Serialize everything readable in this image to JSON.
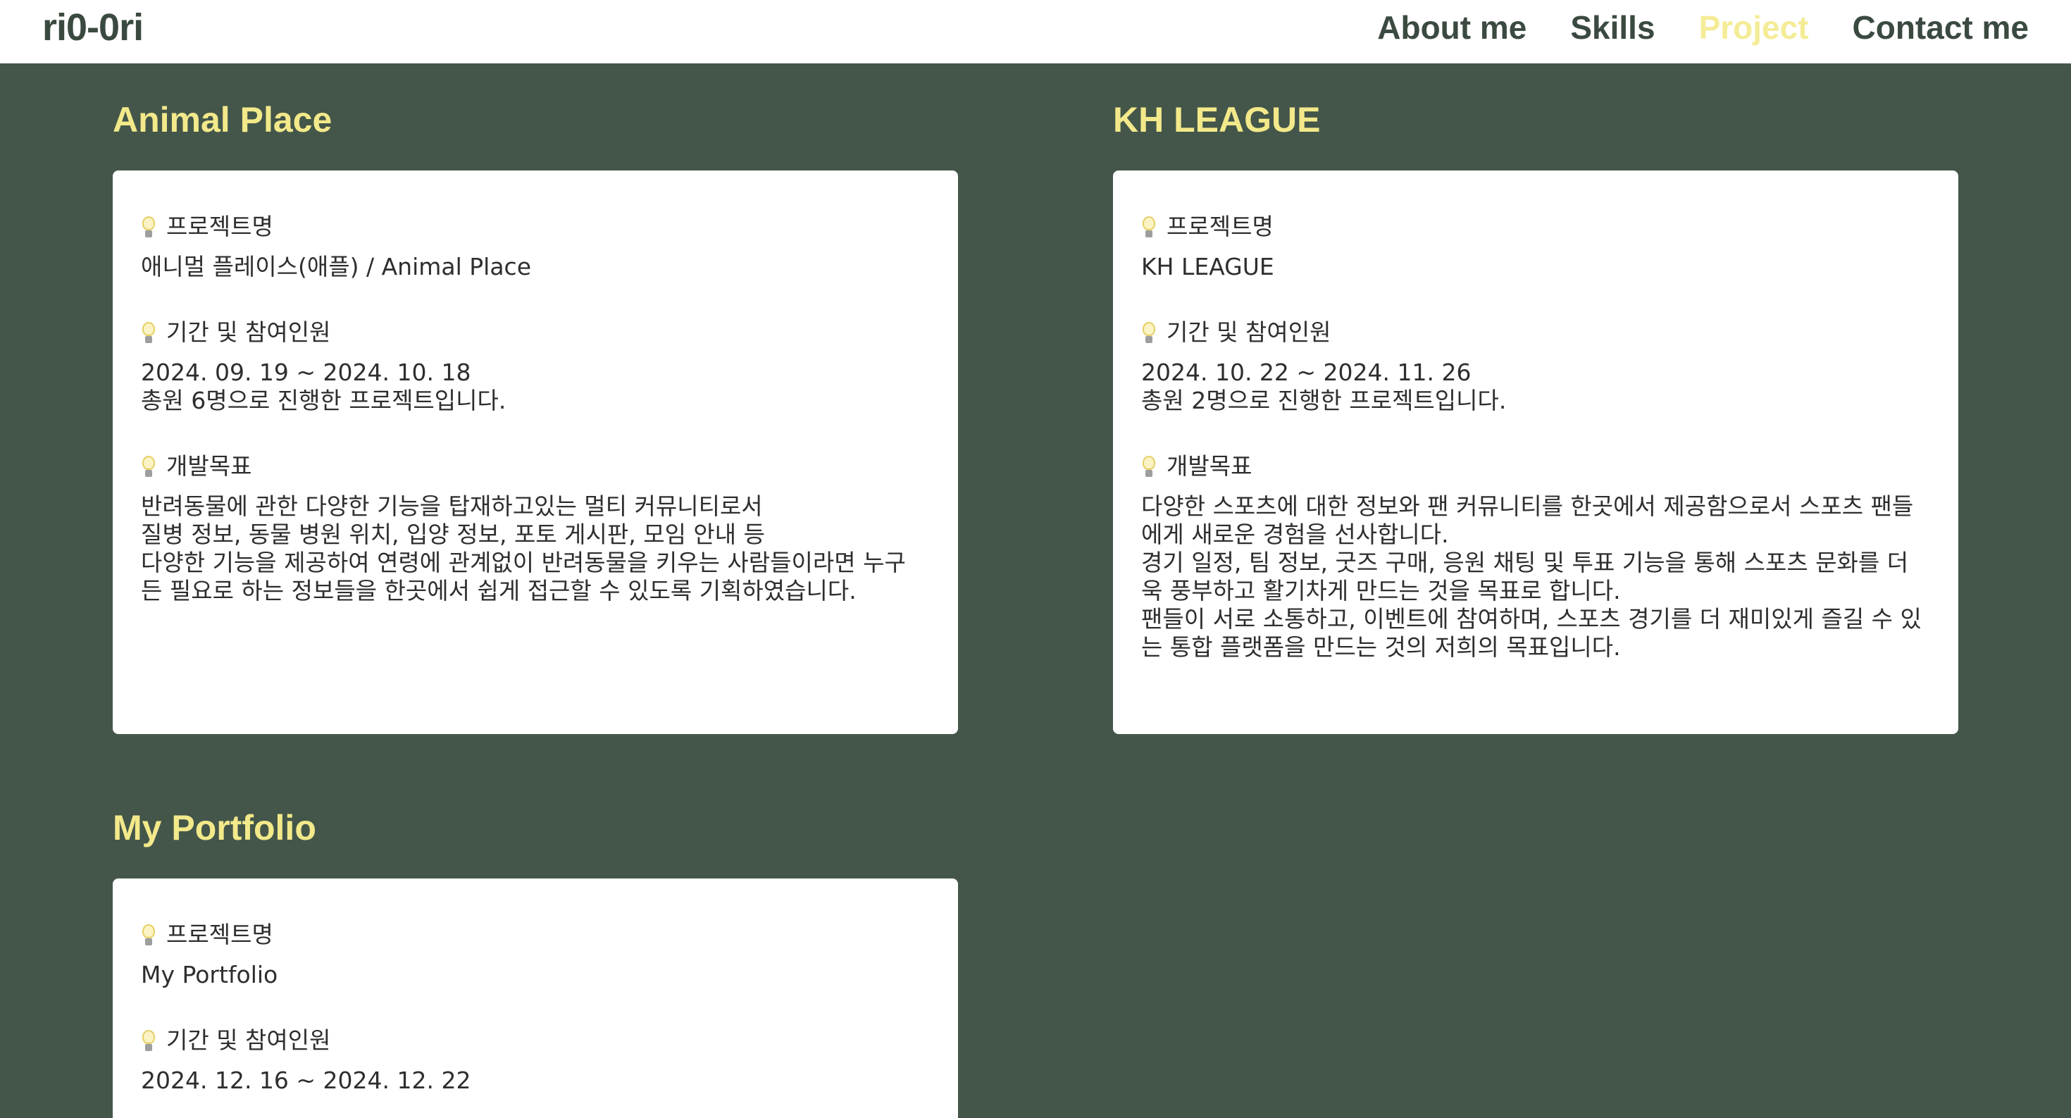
{
  "header": {
    "logo": "ri0-0ri",
    "nav": [
      {
        "label": "About me"
      },
      {
        "label": "Skills"
      },
      {
        "label": "Project"
      },
      {
        "label": "Contact me"
      }
    ],
    "active_nav": "Project"
  },
  "colors": {
    "background": "#44564a",
    "accent": "#f3e98a",
    "header_text": "#3b4a40"
  },
  "projects": [
    {
      "title": "Animal Place",
      "sections": [
        {
          "label": "프로젝트명",
          "icon": "lightbulb-icon",
          "text": "애니멀 플레이스(애플) / Animal Place"
        },
        {
          "label": "기간 및 참여인원",
          "icon": "lightbulb-icon",
          "text": "2024. 09. 19 ~ 2024. 10. 18\n총원 6명으로 진행한 프로젝트입니다."
        },
        {
          "label": "개발목표",
          "icon": "lightbulb-icon",
          "text": "반려동물에 관한 다양한 기능을 탑재하고있는 멀티 커뮤니티로서\n질병 정보, 동물 병원 위치, 입양 정보, 포토 게시판, 모임 안내 등\n다양한 기능을 제공하여 연령에 관계없이 반려동물을 키우는 사람들이라면 누구\n든 필요로 하는 정보들을 한곳에서 쉽게 접근할 수 있도록 기획하였습니다."
        }
      ]
    },
    {
      "title": "KH LEAGUE",
      "sections": [
        {
          "label": "프로젝트명",
          "icon": "lightbulb-icon",
          "text": "KH LEAGUE"
        },
        {
          "label": "기간 및 참여인원",
          "icon": "lightbulb-icon",
          "text": "2024. 10. 22 ~ 2024. 11. 26\n총원 2명으로 진행한 프로젝트입니다."
        },
        {
          "label": "개발목표",
          "icon": "lightbulb-icon",
          "text": "다양한 스포츠에 대한 정보와 팬 커뮤니티를 한곳에서 제공함으로서 스포츠 팬들\n에게 새로운 경험을 선사합니다.\n경기 일정, 팀 정보, 굿즈 구매, 응원 채팅 및 투표 기능을 통해 스포츠 문화를 더\n욱 풍부하고 활기차게 만드는 것을 목표로 합니다.\n팬들이 서로 소통하고, 이벤트에 참여하며, 스포츠 경기를 더 재미있게 즐길 수 있\n는 통합 플랫폼을 만드는 것의 저희의 목표입니다."
        }
      ]
    },
    {
      "title": "My Portfolio",
      "sections": [
        {
          "label": "프로젝트명",
          "icon": "lightbulb-icon",
          "text": "My Portfolio"
        },
        {
          "label": "기간 및 참여인원",
          "icon": "lightbulb-icon",
          "text": "2024. 12. 16 ~ 2024. 12. 22"
        }
      ]
    }
  ]
}
